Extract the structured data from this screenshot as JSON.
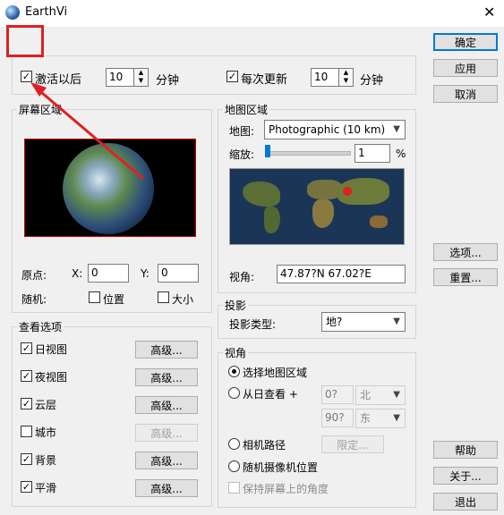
{
  "window": {
    "title": "EarthVi",
    "close_glyph": "✕"
  },
  "top_group": {
    "activate_label": "激活以后",
    "activate_checked": true,
    "activate_value": "10",
    "activate_unit": "分钟",
    "update_label": "每次更新",
    "update_checked": true,
    "update_value": "10",
    "update_unit": "分钟"
  },
  "screen_area": {
    "title": "屏幕区域",
    "origin_label": "原点:",
    "x_label": "X:",
    "x_value": "0",
    "y_label": "Y:",
    "y_value": "0",
    "random_label": "随机:",
    "position_label": "位置",
    "size_label": "大小"
  },
  "map_area": {
    "title": "地图区域",
    "map_label": "地图:",
    "map_value": "Photographic (10 km)",
    "zoom_label": "缩放:",
    "zoom_value": "1",
    "zoom_unit": "%",
    "view_label": "视角:",
    "view_value": "47.87?N   67.02?E"
  },
  "projection": {
    "title": "投影",
    "type_label": "投影类型:",
    "type_value": "地?"
  },
  "view_options": {
    "title": "查看选项",
    "advanced_label": "高级...",
    "items": [
      {
        "label": "日视图",
        "checked": true,
        "enabled": true
      },
      {
        "label": "夜视图",
        "checked": true,
        "enabled": true
      },
      {
        "label": "云层",
        "checked": true,
        "enabled": true
      },
      {
        "label": "城市",
        "checked": false,
        "enabled": false
      },
      {
        "label": "背景",
        "checked": true,
        "enabled": true
      },
      {
        "label": "平滑",
        "checked": true,
        "enabled": true
      }
    ]
  },
  "viewpoint": {
    "title": "视角",
    "select_map_area": "选择地图区域",
    "from_sun": "从日查看 +",
    "lat_value": "0?",
    "lat_dir": "北",
    "lon_value": "90?",
    "lon_dir": "东",
    "camera_path": "相机路径",
    "restrict_label": "限定...",
    "random_camera": "随机摄像机位置",
    "keep_angle": "保持屏幕上的角度"
  },
  "buttons": {
    "ok": "确定",
    "apply": "应用",
    "cancel": "取消",
    "options": "选项...",
    "reset": "重置...",
    "help": "帮助",
    "about": "关于...",
    "exit": "退出"
  },
  "colors": {
    "annotation": "#e02020",
    "accent": "#0078d7"
  }
}
